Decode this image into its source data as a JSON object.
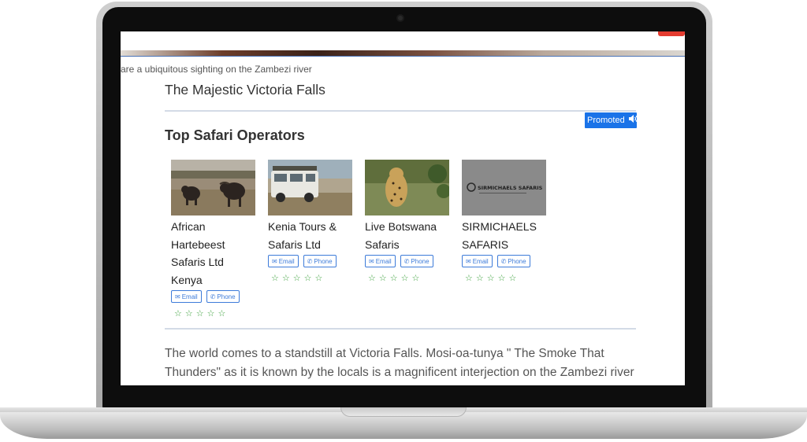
{
  "page": {
    "caption": "are a ubiquitous sighting on the Zambezi river",
    "heading": "The Majestic Victoria Falls",
    "promoted_label": "Promoted",
    "section_title": "Top Safari Operators",
    "body_text": "The world comes to a standstill at Victoria Falls. Mosi-oa-tunya \" The Smoke That Thunders\" as it is known by the locals is a magnificent interjection on the Zambezi river"
  },
  "operators": [
    {
      "name": "African Hartebeest Safaris Ltd Kenya",
      "email_label": "Email",
      "phone_label": "Phone",
      "rating": 0,
      "image": "buffalo-photo"
    },
    {
      "name": "Kenia Tours & Safaris Ltd",
      "email_label": "Email",
      "phone_label": "Phone",
      "rating": 0,
      "image": "safari-vehicle-photo"
    },
    {
      "name": "Live Botswana Safaris",
      "email_label": "Email",
      "phone_label": "Phone",
      "rating": 0,
      "image": "leopard-photo"
    },
    {
      "name": "SIRMICHAELS SAFARIS",
      "email_label": "Email",
      "phone_label": "Phone",
      "rating": 0,
      "image": "sirmichaels-logo",
      "logo_text": "SIRMICHAELS SAFARIS"
    }
  ],
  "colors": {
    "accent": "#1a73e8",
    "link": "#3d7bd9",
    "star": "#3aa03a"
  }
}
